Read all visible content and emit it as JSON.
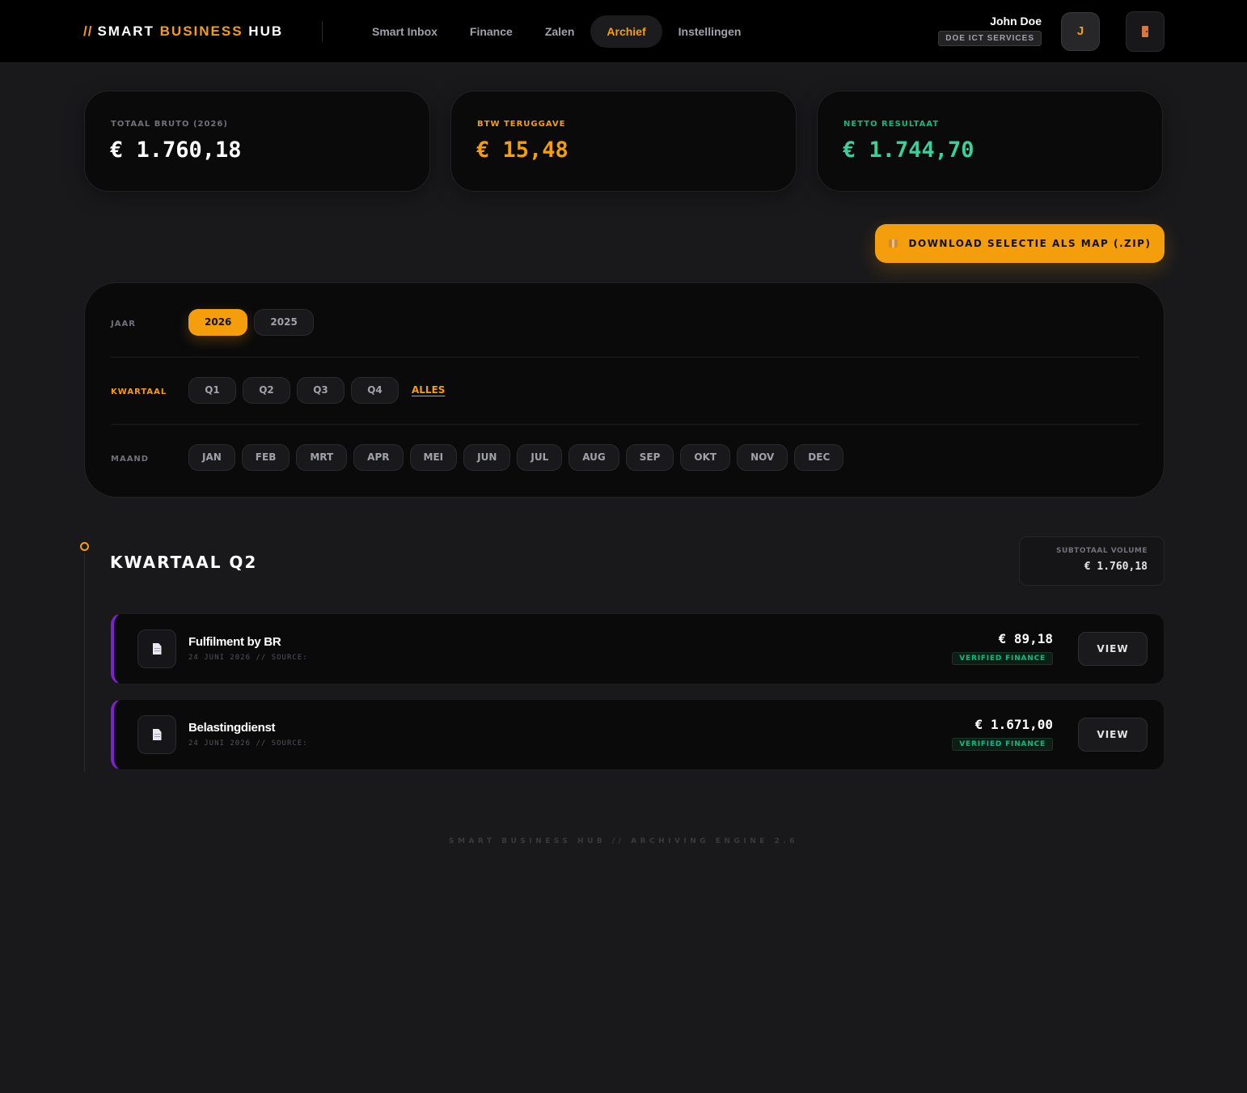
{
  "header": {
    "logo": {
      "slashes": "//",
      "word1": "SMART",
      "word2": "BUSINESS",
      "word3": "HUB"
    },
    "nav": [
      {
        "label": "Smart Inbox",
        "active": false
      },
      {
        "label": "Finance",
        "active": false
      },
      {
        "label": "Zalen",
        "active": false
      },
      {
        "label": "Archief",
        "active": true
      },
      {
        "label": "Instellingen",
        "active": false
      }
    ],
    "user": {
      "name": "John Doe",
      "company": "DOE ICT SERVICES",
      "initial": "J"
    },
    "logout_icon": "door-icon"
  },
  "stats": [
    {
      "label": "TOTAAL BRUTO (2026)",
      "value": "€ 1.760,18"
    },
    {
      "label": "BTW TERUGGAVE",
      "value": "€ 15,48"
    },
    {
      "label": "NETTO RESULTAAT",
      "value": "€ 1.744,70"
    }
  ],
  "download": {
    "icon": "package-icon",
    "label": "DOWNLOAD SELECTIE ALS MAP (.ZIP)"
  },
  "filters": {
    "year": {
      "label": "JAAR",
      "options": [
        "2026",
        "2025"
      ],
      "selected": "2026"
    },
    "quarter": {
      "label": "KWARTAAL",
      "options": [
        "Q1",
        "Q2",
        "Q3",
        "Q4"
      ],
      "all_label": "ALLES"
    },
    "month": {
      "label": "MAAND",
      "options": [
        "JAN",
        "FEB",
        "MRT",
        "APR",
        "MEI",
        "JUN",
        "JUL",
        "AUG",
        "SEP",
        "OKT",
        "NOV",
        "DEC"
      ]
    }
  },
  "quarter_section": {
    "title": "KWARTAAL Q2",
    "subtotal_label": "SUBTOTAAL VOLUME",
    "subtotal_value": "€ 1.760,18",
    "documents": [
      {
        "name": "Fulfilment by BR",
        "meta": "24 JUNI 2026 // SOURCE:",
        "amount": "€ 89,18",
        "badge": "VERIFIED FINANCE",
        "action": "VIEW",
        "icon": "file-icon"
      },
      {
        "name": "Belastingdienst",
        "meta": "24 JUNI 2026 // SOURCE:",
        "amount": "€ 1.671,00",
        "badge": "VERIFIED FINANCE",
        "action": "VIEW",
        "icon": "file-icon"
      }
    ]
  },
  "footer": {
    "text": "SMART BUSINESS HUB // ARCHIVING ENGINE 2.6"
  },
  "colors": {
    "accent": "#f59e0b",
    "positive": "#34d399",
    "doc_border": "#7e22ce",
    "background": "#19191b"
  }
}
